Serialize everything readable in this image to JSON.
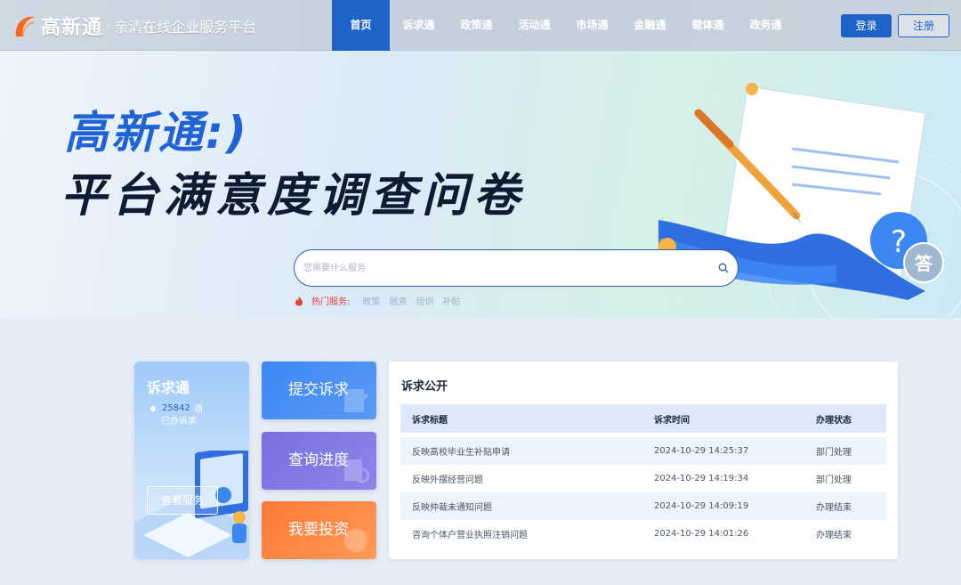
{
  "nav": {
    "logo_name": "高新通",
    "logo_dot": "·",
    "slogan": "亲清在线企业服务平台",
    "menu": [
      {
        "label": "首页",
        "active": true
      },
      {
        "label": "诉求通",
        "active": false
      },
      {
        "label": "政策通",
        "active": false
      },
      {
        "label": "活动通",
        "active": false
      },
      {
        "label": "市场通",
        "active": false
      },
      {
        "label": "金融通",
        "active": false
      },
      {
        "label": "载体通",
        "active": false
      },
      {
        "label": "政务通",
        "active": false
      }
    ],
    "login_label": "登录",
    "register_label": "注册"
  },
  "hero": {
    "title_line1": "高新通:)",
    "title_line2": "平台满意度调查问卷",
    "search_placeholder": "您需要什么服务",
    "hot_label": "热门服务:",
    "hot_tags": [
      "政策",
      "融资",
      "培训",
      "补贴"
    ],
    "badge_question": "?",
    "badge_answer": "答"
  },
  "left_card": {
    "title": "诉求通",
    "count": "25842",
    "unit": "项",
    "sub": "已办诉求",
    "button": "查看服务"
  },
  "actions": [
    {
      "label": "提交诉求"
    },
    {
      "label": "查询进度"
    },
    {
      "label": "我要投资"
    }
  ],
  "panel": {
    "title": "诉求公开",
    "headers": [
      "诉求标题",
      "诉求时间",
      "办理状态"
    ],
    "rows": [
      {
        "title": "反映高校毕业生补贴申请",
        "time": "2024-10-29 14:25:37",
        "status": "部门处理"
      },
      {
        "title": "反映外摆经营问题",
        "time": "2024-10-29 14:19:34",
        "status": "部门处理"
      },
      {
        "title": "反映仲裁未通知问题",
        "time": "2024-10-29 14:09:19",
        "status": "办理结束"
      },
      {
        "title": "咨询个体户营业执照注销问题",
        "time": "2024-10-29 14:01:26",
        "status": "办理结束"
      }
    ]
  },
  "colors": {
    "primary": "#1f63c9",
    "hot": "#e0453a",
    "action1": "#3d87f3",
    "action2": "#7a6fe0",
    "action3": "#ff7a35"
  },
  "icons": [
    "logo-arc-icon",
    "search-icon",
    "fire-icon",
    "question-bubble-icon",
    "answer-bubble-icon",
    "pen-icon",
    "document-icon"
  ]
}
